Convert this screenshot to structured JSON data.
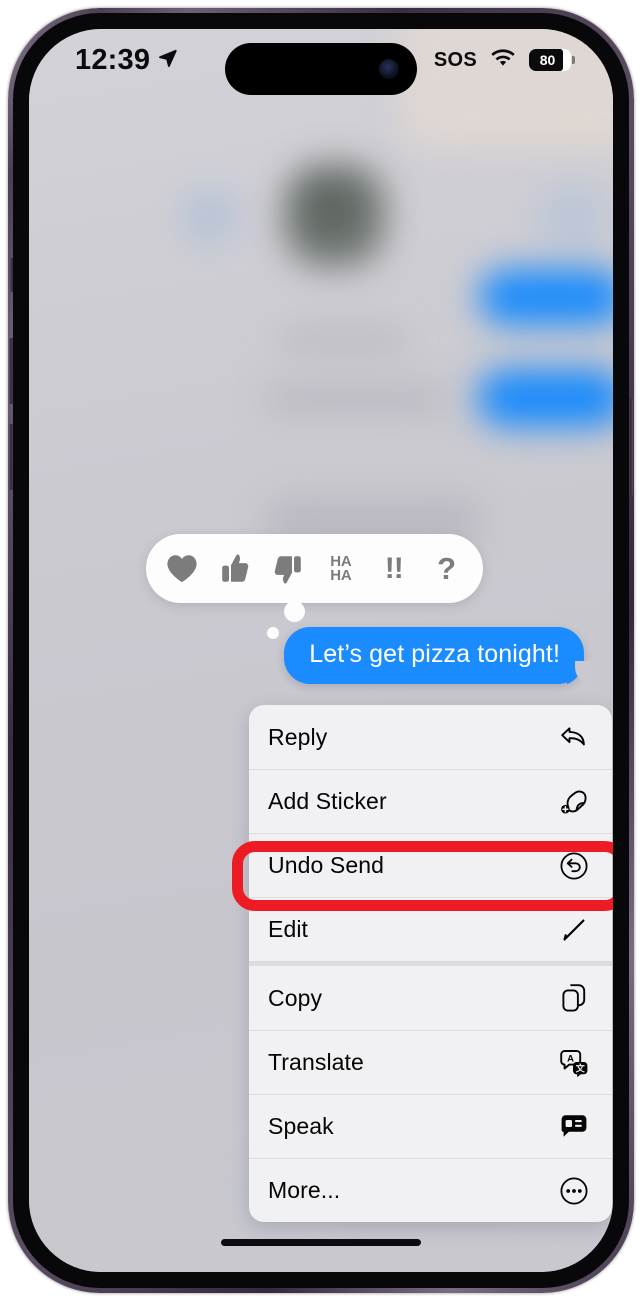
{
  "device": {
    "name": "iPhone",
    "frame_color": "#4b3f52",
    "screen_bg": "#c9c9cf"
  },
  "status_bar": {
    "time": "12:39",
    "location_icon": "location-arrow-icon",
    "carrier_status": "SOS",
    "wifi_icon": "wifi-icon",
    "battery_level": "80",
    "battery_percent": 80,
    "dynamic_island": "dynamic-island",
    "camera_icon": "front-camera-icon"
  },
  "reaction_bar": {
    "items": [
      {
        "name": "heart",
        "icon": "heart-icon",
        "label": ""
      },
      {
        "name": "thumbs-up",
        "icon": "thumbs-up-icon",
        "label": ""
      },
      {
        "name": "thumbs-down",
        "icon": "thumbs-down-icon",
        "label": ""
      },
      {
        "name": "haha",
        "icon": "haha-text-icon",
        "label_line1": "HA",
        "label_line2": "HA"
      },
      {
        "name": "exclamation",
        "icon": "double-exclamation-icon",
        "label": "!!"
      },
      {
        "name": "question",
        "icon": "question-mark-icon",
        "label": "?"
      }
    ]
  },
  "message": {
    "text": "Let’s get pizza tonight!",
    "bubble_color": "#1a8cff",
    "text_color": "#ffffff",
    "alignment": "outgoing"
  },
  "context_menu": {
    "groups": [
      {
        "items": [
          {
            "label": "Reply",
            "icon": "reply-arrow-icon",
            "highlighted": false
          },
          {
            "label": "Add Sticker",
            "icon": "add-sticker-icon",
            "highlighted": false
          },
          {
            "label": "Undo Send",
            "icon": "undo-circle-icon",
            "highlighted": true
          },
          {
            "label": "Edit",
            "icon": "pencil-icon",
            "highlighted": false
          }
        ]
      },
      {
        "items": [
          {
            "label": "Copy",
            "icon": "copy-documents-icon",
            "highlighted": false
          },
          {
            "label": "Translate",
            "icon": "translate-icon",
            "highlighted": false
          },
          {
            "label": "Speak",
            "icon": "speak-bubble-icon",
            "highlighted": false
          },
          {
            "label": "More...",
            "icon": "ellipsis-circle-icon",
            "highlighted": false
          }
        ]
      }
    ]
  },
  "annotation": {
    "target": "Undo Send",
    "shape": "rounded-rectangle",
    "color": "#ed1c24",
    "stroke_width": 11
  },
  "home_indicator": "home-indicator"
}
